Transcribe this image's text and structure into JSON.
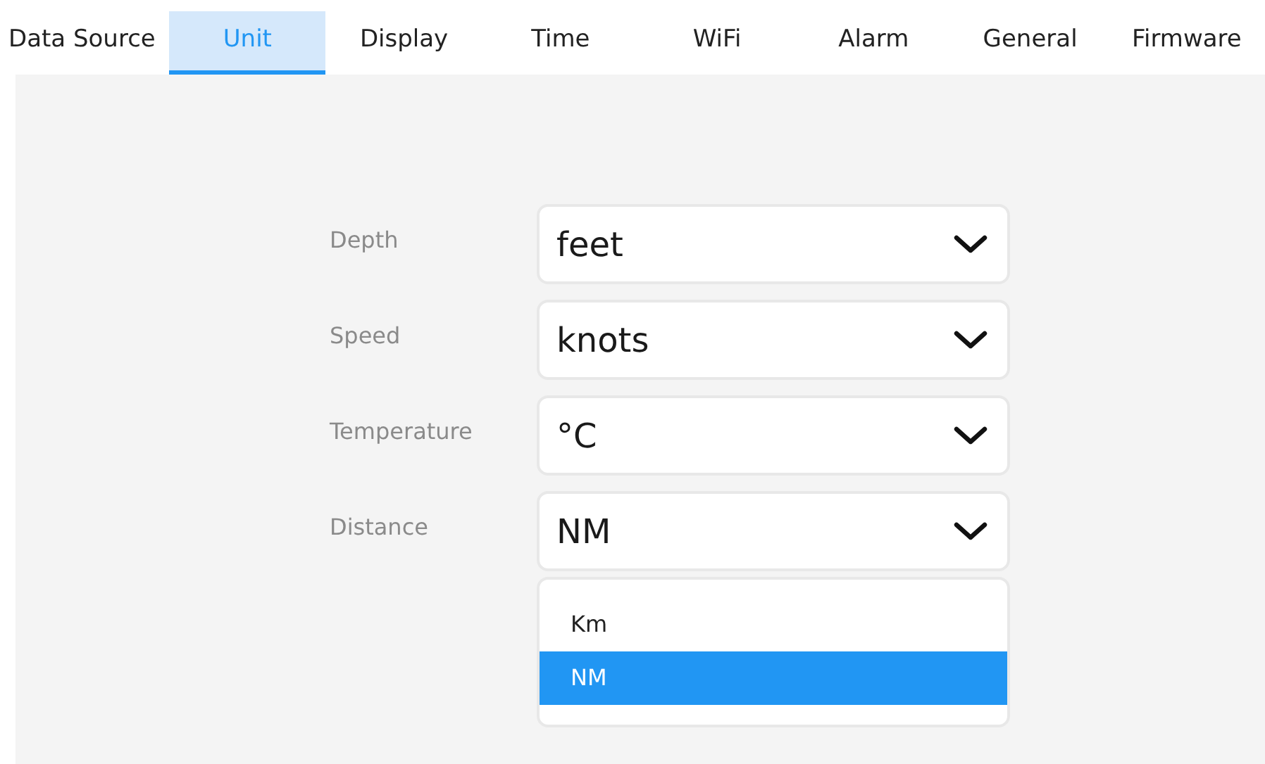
{
  "tabs": [
    {
      "label": "Data Source",
      "selected": false
    },
    {
      "label": "Unit",
      "selected": true
    },
    {
      "label": "Display",
      "selected": false
    },
    {
      "label": "Time",
      "selected": false
    },
    {
      "label": "WiFi",
      "selected": false
    },
    {
      "label": "Alarm",
      "selected": false
    },
    {
      "label": "General",
      "selected": false
    },
    {
      "label": "Firmware",
      "selected": false
    }
  ],
  "settings": [
    {
      "label": "Depth",
      "value": "feet"
    },
    {
      "label": "Speed",
      "value": "knots"
    },
    {
      "label": "Temperature",
      "value": "°C"
    },
    {
      "label": "Distance",
      "value": "NM",
      "options": [
        {
          "label": "Km",
          "selected": false
        },
        {
          "label": "NM",
          "selected": true
        }
      ]
    }
  ]
}
